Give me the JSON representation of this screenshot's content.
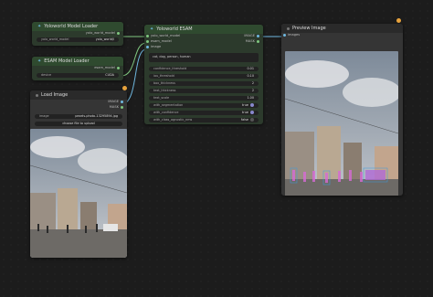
{
  "nodes": {
    "world_loader": {
      "title": "Yoloworld Model Loader",
      "output": "yolo_world_model",
      "widget_label": "yolo_world_model",
      "widget_value": "yolo_world/l"
    },
    "esam_loader": {
      "title": "ESAM Model Loader",
      "output": "esam_model",
      "widget_label": "device",
      "widget_value": "CUDA"
    },
    "load_image": {
      "title": "Load Image",
      "outputs": [
        "IMAGE",
        "MASK"
      ],
      "widget_label": "image",
      "widget_value": "pexels-photo-13295894.jpg",
      "upload_label": "choose file to upload"
    },
    "esam": {
      "title": "Yoloworld ESAM",
      "inputs": [
        "yolo_world_model",
        "esam_model",
        "image"
      ],
      "outputs": [
        "IMAGE",
        "MASK"
      ],
      "text_prompt": "cat, dog, person, human",
      "widgets": [
        {
          "label": "confidence_threshold",
          "value": "0.01"
        },
        {
          "label": "iou_threshold",
          "value": "0.10"
        },
        {
          "label": "box_thickness",
          "value": "2"
        },
        {
          "label": "text_thickness",
          "value": "2"
        },
        {
          "label": "text_scale",
          "value": "1.00"
        },
        {
          "label": "with_segmentation",
          "value": "true"
        },
        {
          "label": "with_confidence",
          "value": "true"
        },
        {
          "label": "with_class_agnostic_nms",
          "value": "false"
        }
      ]
    },
    "preview": {
      "title": "Preview Image",
      "input": "images"
    }
  },
  "colors": {
    "green_header": "#2f4a2f",
    "link_blue": "#6fb8e0",
    "link_green": "#7fc77f",
    "badge": "#e8a33d"
  }
}
